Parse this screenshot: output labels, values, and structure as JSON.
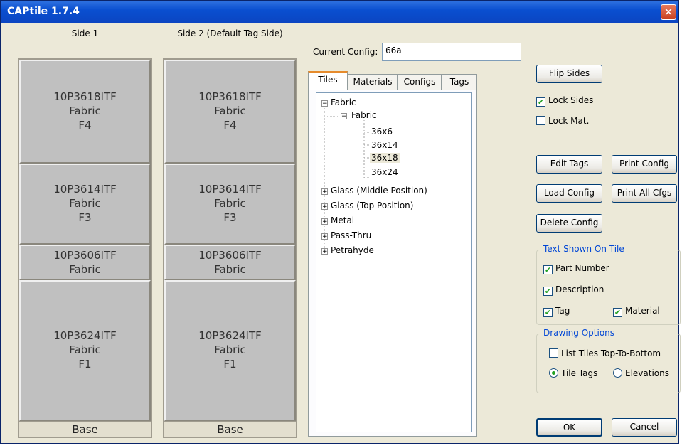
{
  "window": {
    "title": "CAPtile 1.7.4",
    "close_glyph": "✕"
  },
  "sides": [
    {
      "label": "Side 1",
      "tiles": [
        {
          "lines": [
            "10P3618ITF",
            "Fabric",
            "F4"
          ]
        },
        {
          "lines": [
            "10P3614ITF",
            "Fabric",
            "F3"
          ]
        },
        {
          "lines": [
            "10P3606ITF",
            "Fabric"
          ]
        },
        {
          "lines": [
            "10P3624ITF",
            "Fabric",
            "F1"
          ]
        }
      ],
      "base": "Base"
    },
    {
      "label": "Side 2 (Default Tag Side)",
      "tiles": [
        {
          "lines": [
            "10P3618ITF",
            "Fabric",
            "F4"
          ]
        },
        {
          "lines": [
            "10P3614ITF",
            "Fabric",
            "F3"
          ]
        },
        {
          "lines": [
            "10P3606ITF",
            "Fabric"
          ]
        },
        {
          "lines": [
            "10P3624ITF",
            "Fabric",
            "F1"
          ]
        }
      ],
      "base": "Base"
    }
  ],
  "config": {
    "label": "Current Config:",
    "value": "66a"
  },
  "tabs": [
    "Tiles",
    "Materials",
    "Configs",
    "Tags"
  ],
  "tree": {
    "root": "Fabric",
    "sub": "Fabric",
    "leaves": [
      "36x6",
      "36x14",
      "36x18",
      "36x24"
    ],
    "selected_leaf": "36x18",
    "others": [
      "Glass (Middle Position)",
      "Glass (Top Position)",
      "Metal",
      "Pass-Thru",
      "Petrahyde"
    ],
    "expanded_glyph": "−",
    "collapsed_glyph": "+"
  },
  "buttons": {
    "flip_sides": "Flip Sides",
    "edit_tags": "Edit Tags",
    "print_config": "Print Config",
    "load_config": "Load Config",
    "print_all": "Print All Cfgs",
    "delete_config": "Delete Config",
    "ok": "OK",
    "cancel": "Cancel"
  },
  "checks": {
    "lock_sides": {
      "label": "Lock Sides",
      "checked": true
    },
    "lock_mat": {
      "label": "Lock Mat.",
      "checked": false
    }
  },
  "text_group": {
    "title": "Text Shown On Tile",
    "part_number": {
      "label": "Part Number",
      "checked": true
    },
    "description": {
      "label": "Description",
      "checked": true
    },
    "tag": {
      "label": "Tag",
      "checked": true
    },
    "material": {
      "label": "Material",
      "checked": true
    }
  },
  "drawing_group": {
    "title": "Drawing Options",
    "list_top": {
      "label": "List Tiles Top-To-Bottom",
      "checked": false
    },
    "tile_tags": {
      "label": "Tile Tags",
      "selected": true
    },
    "elevations": {
      "label": "Elevations",
      "selected": false
    }
  },
  "check_glyph": "✔"
}
